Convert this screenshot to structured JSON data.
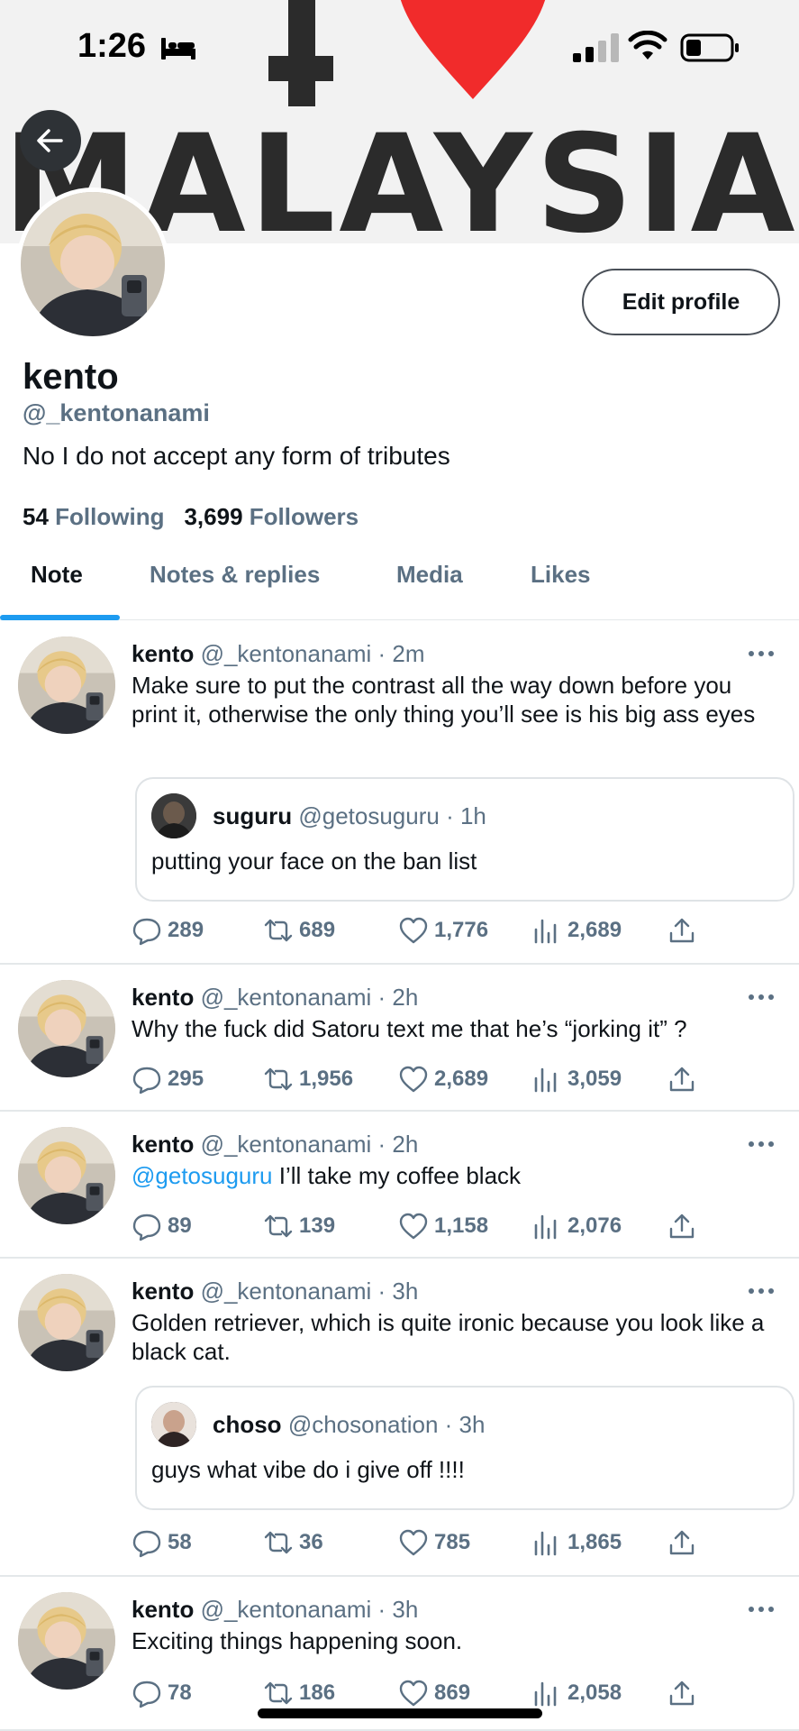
{
  "status_bar": {
    "time": "1:26",
    "icons": [
      "bed-icon",
      "signal-icon",
      "wifi-icon",
      "battery-icon"
    ]
  },
  "banner": {
    "letter": "I",
    "word": "MALAYSIA",
    "heart_color": "#f12b2b",
    "text_color": "#2b2b2b"
  },
  "profile": {
    "display_name": "kento",
    "handle": "@_kentonanami",
    "bio": "No I do not accept any form of tributes",
    "following_count": "54",
    "following_label": "Following",
    "followers_count": "3,699",
    "followers_label": "Followers",
    "edit_button": "Edit profile"
  },
  "tabs": [
    {
      "label": "Note",
      "active": true
    },
    {
      "label": "Notes & replies",
      "active": false
    },
    {
      "label": "Media",
      "active": false
    },
    {
      "label": "Likes",
      "active": false
    }
  ],
  "colors": {
    "accent": "#1d9bf0",
    "secondary_text": "#5b7083",
    "divider": "#e4e8ea"
  },
  "tweets": [
    {
      "name": "kento",
      "meta": "@_kentonanami · 2m",
      "text": "Make sure to put the contrast all the way down before you print it, otherwise the only thing you’ll see is his big ass eyes",
      "quote": {
        "name": "suguru",
        "meta": "@getosuguru · 1h",
        "text": "putting your face on the ban list"
      },
      "replies": "289",
      "retweets": "689",
      "likes": "1,776",
      "views": "2,689"
    },
    {
      "name": "kento",
      "meta": "@_kentonanami · 2h",
      "text": "Why the fuck did Satoru text me that he’s “jorking it” ?",
      "replies": "295",
      "retweets": "1,956",
      "likes": "2,689",
      "views": "3,059"
    },
    {
      "name": "kento",
      "meta": "@_kentonanami · 2h",
      "mention": "@getosuguru",
      "text": " I’ll take my coffee black",
      "replies": "89",
      "retweets": "139",
      "likes": "1,158",
      "views": "2,076"
    },
    {
      "name": "kento",
      "meta": "@_kentonanami · 3h",
      "text": "Golden retriever, which is quite ironic because you look like a black cat.",
      "quote": {
        "name": "choso",
        "meta": "@chosonation · 3h",
        "text": "guys what vibe do i give off !!!!"
      },
      "replies": "58",
      "retweets": "36",
      "likes": "785",
      "views": "1,865"
    },
    {
      "name": "kento",
      "meta": "@_kentonanami · 3h",
      "text": "Exciting things happening soon.",
      "replies": "78",
      "retweets": "186",
      "likes": "869",
      "views": "2,058"
    }
  ]
}
